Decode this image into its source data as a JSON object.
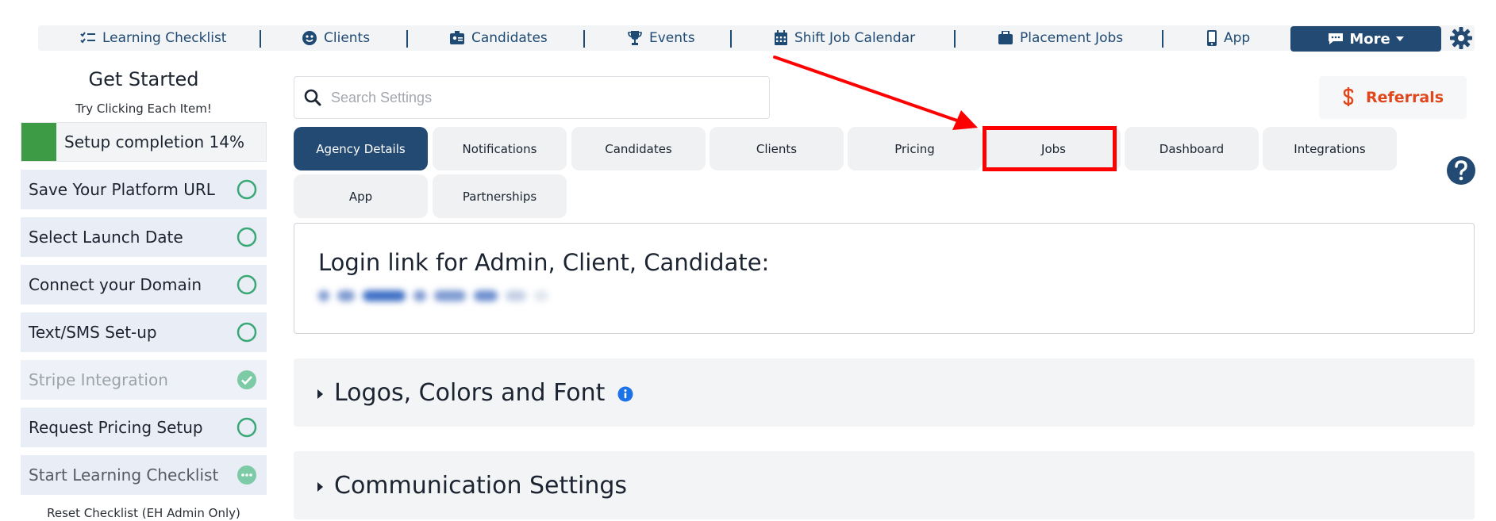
{
  "nav": {
    "items": [
      {
        "label": "Learning Checklist",
        "icon": "checklist-icon"
      },
      {
        "label": "Clients",
        "icon": "user-circle-icon"
      },
      {
        "label": "Candidates",
        "icon": "id-badge-icon"
      },
      {
        "label": "Events",
        "icon": "trophy-icon"
      },
      {
        "label": "Shift Job Calendar",
        "icon": "calendar-icon"
      },
      {
        "label": "Placement Jobs",
        "icon": "briefcase-icon"
      },
      {
        "label": "App",
        "icon": "phone-icon"
      }
    ],
    "more_label": "More",
    "settings_icon": "gear-icon"
  },
  "sidebar": {
    "title": "Get Started",
    "subtitle": "Try Clicking Each Item!",
    "progress_label": "Setup completion 14%",
    "progress_fraction": 0.14,
    "items": [
      {
        "label": "Save Your Platform URL",
        "status": "open"
      },
      {
        "label": "Select Launch Date",
        "status": "open"
      },
      {
        "label": "Connect your Domain",
        "status": "open"
      },
      {
        "label": "Text/SMS Set-up",
        "status": "open"
      },
      {
        "label": "Stripe Integration",
        "status": "done"
      },
      {
        "label": "Request Pricing Setup",
        "status": "open"
      },
      {
        "label": "Start Learning Checklist",
        "status": "in-progress"
      }
    ],
    "reset_label": "Reset Checklist (EH Admin Only)"
  },
  "search": {
    "placeholder": "Search Settings",
    "value": ""
  },
  "referrals": {
    "label": "Referrals",
    "icon": "dollar-icon"
  },
  "tabs": [
    {
      "label": "Agency Details",
      "active": true
    },
    {
      "label": "Notifications",
      "active": false
    },
    {
      "label": "Candidates",
      "active": false
    },
    {
      "label": "Clients",
      "active": false
    },
    {
      "label": "Pricing",
      "active": false
    },
    {
      "label": "Jobs",
      "active": false,
      "highlighted": true
    },
    {
      "label": "Dashboard",
      "active": false
    },
    {
      "label": "Integrations",
      "active": false
    },
    {
      "label": "App",
      "active": false
    },
    {
      "label": "Partnerships",
      "active": false
    }
  ],
  "login_card": {
    "title": "Login link for Admin, Client, Candidate:"
  },
  "sections": [
    {
      "title": "Logos, Colors and Font",
      "has_info_icon": true
    },
    {
      "title": "Communication Settings",
      "has_info_icon": false
    }
  ],
  "colors": {
    "primary": "#234a72",
    "nav_text": "#1f4a73",
    "progress": "#3d9b45",
    "status_green": "#3aa876",
    "referrals": "#e0471c",
    "annotation_red": "#ff0000",
    "info_blue": "#1a73e8"
  }
}
